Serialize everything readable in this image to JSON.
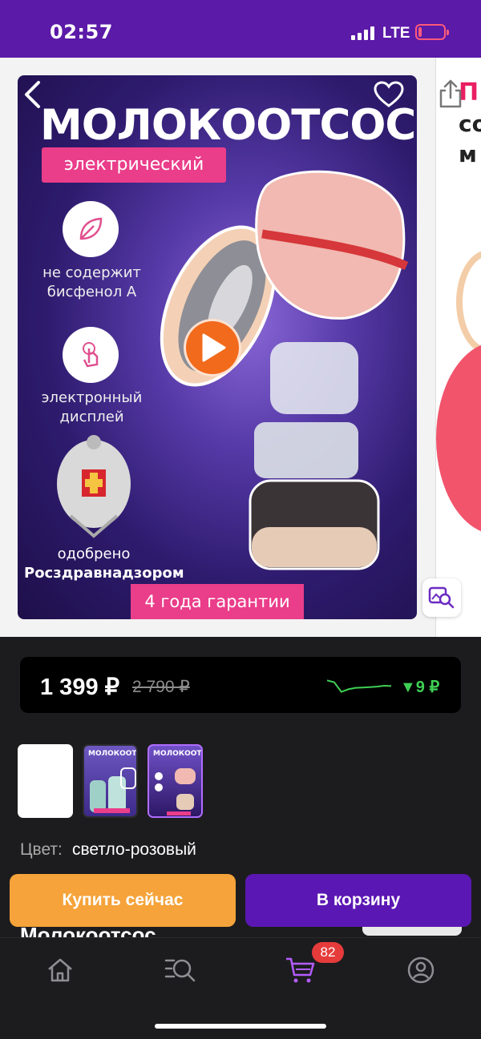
{
  "status_bar": {
    "time": "02:57",
    "network": "LTE"
  },
  "gallery": {
    "product_title": "МОЛОКООТСОС",
    "subtitle_badge": "электрический",
    "feature1": [
      "не содержит",
      "бисфенол А"
    ],
    "feature2": [
      "электронный",
      "дисплей"
    ],
    "approved_line1": "одобрено",
    "approved_line2": "Росздравнадзором",
    "warranty": "4 года гарантии",
    "next_slide_title": "П",
    "next_slide_line1": "со",
    "next_slide_line2": "м"
  },
  "price": {
    "current": "1 399 ₽",
    "old": "2 790 ₽",
    "drop": "▼9 ₽",
    "history_trend": [
      0.2,
      0.3,
      0.85,
      0.7,
      0.62,
      0.6,
      0.58,
      0.55,
      0.5,
      0.52
    ]
  },
  "thumbnails": {
    "label": "МОЛОКООТСОС"
  },
  "color": {
    "label": "Цвет:",
    "value": "светло-розовый"
  },
  "actions": {
    "buy_now": "Купить сейчас",
    "add_to_cart": "В корзину"
  },
  "peek": {
    "title": "Молокоотсос"
  },
  "tab_bar": {
    "cart_count": "82"
  },
  "colors": {
    "brand_purple": "#5b1aa8",
    "buy_orange": "#f5a33a",
    "cart_purple": "#5b17b3",
    "badge_pink": "#ea3d8a",
    "price_green": "#3fcf54"
  }
}
